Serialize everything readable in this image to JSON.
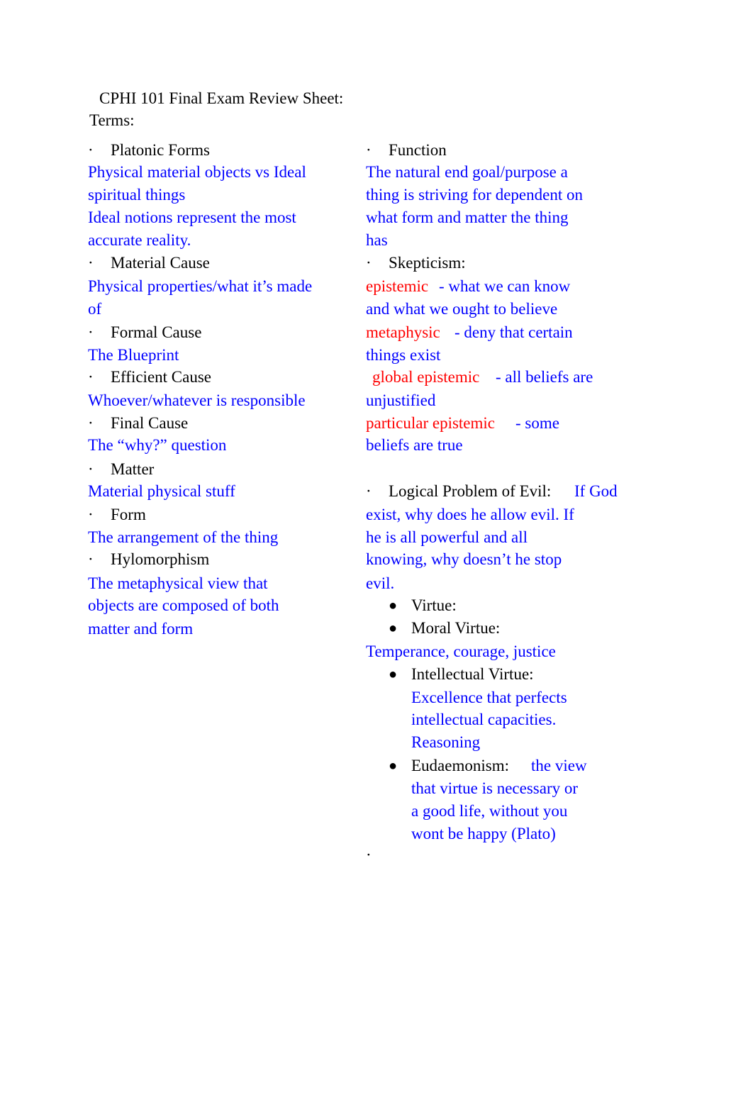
{
  "title": "CPHI 101 Final Exam Review Sheet:",
  "subtitle": "Terms:",
  "bullet_small": "·",
  "bullet_big": "●",
  "left_column": [
    {
      "term": "Platonic Forms",
      "definition_lines": [
        "Physical material objects vs Ideal",
        "spiritual things",
        "Ideal notions represent the most",
        "accurate reality."
      ]
    },
    {
      "term": "Material Cause",
      "definition_lines": [
        "Physical properties/what it’s made",
        "of"
      ]
    },
    {
      "term": "Formal Cause",
      "definition_lines": [
        "The Blueprint"
      ]
    },
    {
      "term": "Efficient Cause",
      "definition_lines": [
        "Whoever/whatever is responsible"
      ]
    },
    {
      "term": "Final Cause",
      "definition_lines": [
        "The “why?” question"
      ]
    },
    {
      "term": "Matter",
      "definition_lines": [
        "Material physical stuff"
      ]
    },
    {
      "term": "Form",
      "definition_lines": [
        "The arrangement of the thing"
      ]
    },
    {
      "term": "Hylomorphism",
      "definition_lines": [
        "The metaphysical view that",
        "objects are composed of both",
        "matter and form"
      ]
    }
  ],
  "right_column": {
    "function": {
      "term": "Function",
      "definition_lines": [
        "The natural end goal/purpose a",
        "thing is striving for dependent on",
        "what form and matter the thing",
        "has"
      ]
    },
    "skepticism": {
      "term": "Skepticism:",
      "types": [
        {
          "name": "epistemic",
          "definition_lines": [
            "- what we can know",
            "and what we ought to believe"
          ]
        },
        {
          "name": "metaphysic",
          "definition_lines": [
            "- deny that certain",
            "things exist"
          ]
        },
        {
          "name": "global epistemic",
          "definition_lines": [
            "- all beliefs are",
            "unjustified"
          ]
        },
        {
          "name": "particular epistemic",
          "definition_lines": [
            "- some",
            "beliefs are true"
          ]
        }
      ]
    },
    "evil": {
      "term": "Logical Problem of Evil:",
      "definition_lines": [
        "If God",
        "exist, why does he allow evil. If",
        "he is all powerful and all",
        "knowing, why doesn’t he stop",
        "evil."
      ]
    },
    "virtue": {
      "term": "Virtue:"
    },
    "moral_virtue": {
      "term": "Moral Virtue:",
      "definition_lines": [
        "Temperance, courage, justice"
      ]
    },
    "intellectual_virtue": {
      "term": "Intellectual Virtue:",
      "definition_lines": [
        "Excellence that perfects",
        "intellectual capacities.",
        "Reasoning"
      ]
    },
    "eudaemonism": {
      "term": "Eudaemonism:",
      "definition_lines": [
        "the view",
        "that virtue is necessary or",
        "a good life, without you",
        "wont be happy (Plato)"
      ]
    }
  },
  "colors": {
    "term": "#000000",
    "definition": "#0000ff",
    "highlight": "#ff0000"
  }
}
